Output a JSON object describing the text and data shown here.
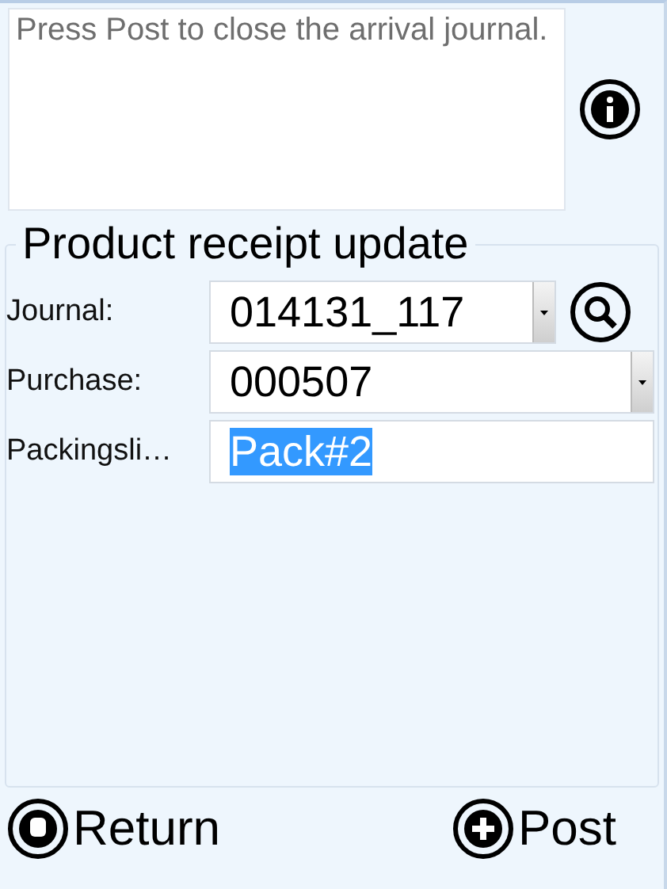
{
  "message": {
    "text": "Press Post to close the arrival journal."
  },
  "form": {
    "title": "Product receipt update",
    "fields": [
      {
        "kind": "combo",
        "label": "Journal:",
        "value": "014131_117",
        "lookup": true,
        "highlighted": false
      },
      {
        "kind": "combo",
        "label": "Purchase:",
        "value": "000507",
        "lookup": false,
        "highlighted": false
      },
      {
        "kind": "text",
        "label": "Packingsli…",
        "value": "Pack#2",
        "lookup": false,
        "highlighted": true
      }
    ]
  },
  "buttons": [
    {
      "kind": "return",
      "label": "Return"
    },
    {
      "kind": "post",
      "label": "Post"
    }
  ]
}
